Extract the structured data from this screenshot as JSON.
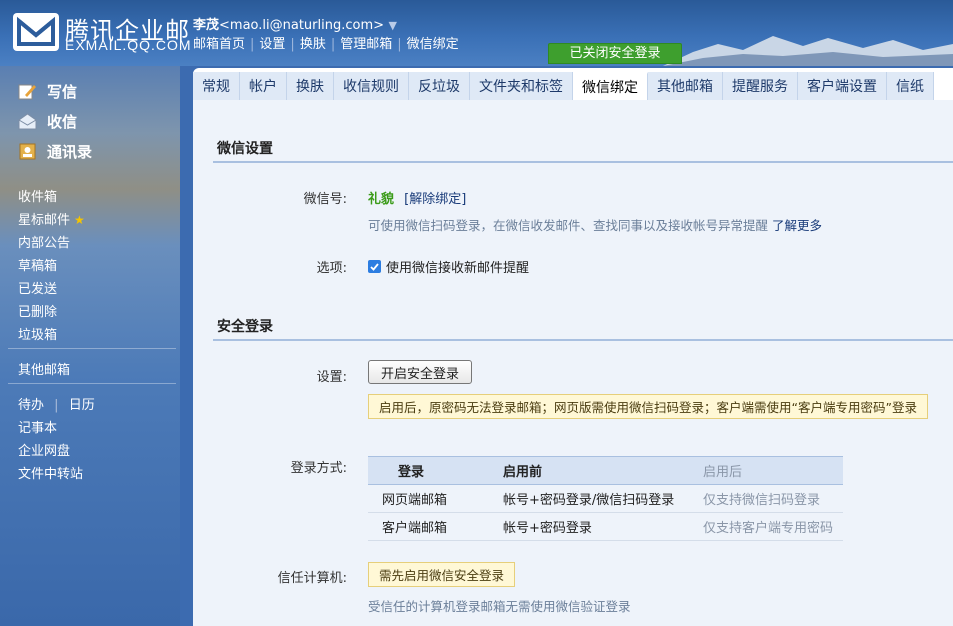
{
  "brand": {
    "name_cn": "腾讯企业邮",
    "name_en": "EXMAIL.QQ.COM"
  },
  "user": {
    "name": "李茂",
    "email": "<mao.li@naturling.com>",
    "caret": "▼"
  },
  "top_links": [
    "邮箱首页",
    "设置",
    "换肤",
    "管理邮箱",
    "微信绑定"
  ],
  "secure_badge": "已关闭安全登录",
  "sidebar": {
    "main": [
      {
        "label": "写信",
        "icon": "compose-icon"
      },
      {
        "label": "收信",
        "icon": "inbox-icon"
      },
      {
        "label": "通讯录",
        "icon": "contacts-icon"
      }
    ],
    "folders": [
      "收件箱",
      "星标邮件",
      "内部公告",
      "草稿箱",
      "已发送",
      "已删除",
      "垃圾箱"
    ],
    "other": "其他邮箱",
    "tools": {
      "todo": "待办",
      "sep": "|",
      "calendar": "日历",
      "notes": "记事本",
      "disk": "企业网盘",
      "transfer": "文件中转站"
    }
  },
  "tabs": [
    "常规",
    "帐户",
    "换肤",
    "收信规则",
    "反垃圾",
    "文件夹和标签",
    "微信绑定",
    "其他邮箱",
    "提醒服务",
    "客户端设置",
    "信纸"
  ],
  "active_tab": "微信绑定",
  "wechat": {
    "section_title": "微信设置",
    "account_label": "微信号:",
    "account_name": "礼貌",
    "unbind": "[解除绑定]",
    "hint": "可使用微信扫码登录，在微信收发邮件、查找同事以及接收帐号异常提醒",
    "learn_more": "了解更多",
    "option_label": "选项:",
    "option_text": "使用微信接收新邮件提醒",
    "option_checked": true
  },
  "security": {
    "section_title": "安全登录",
    "setting_label": "设置:",
    "enable_button": "开启安全登录",
    "warning": "启用后，原密码无法登录邮箱；网页版需使用微信扫码登录；客户端需使用“客户端专用密码”登录",
    "method_label": "登录方式:",
    "table": {
      "headers": [
        "登录",
        "启用前",
        "启用后"
      ],
      "rows": [
        [
          "网页端邮箱",
          "帐号+密码登录/微信扫码登录",
          "仅支持微信扫码登录"
        ],
        [
          "客户端邮箱",
          "帐号+密码登录",
          "仅支持客户端专用密码"
        ]
      ]
    },
    "trusted_label": "信任计算机:",
    "trusted_notice": "需先启用微信安全登录",
    "trusted_hint": "受信任的计算机登录邮箱无需使用微信验证登录"
  }
}
